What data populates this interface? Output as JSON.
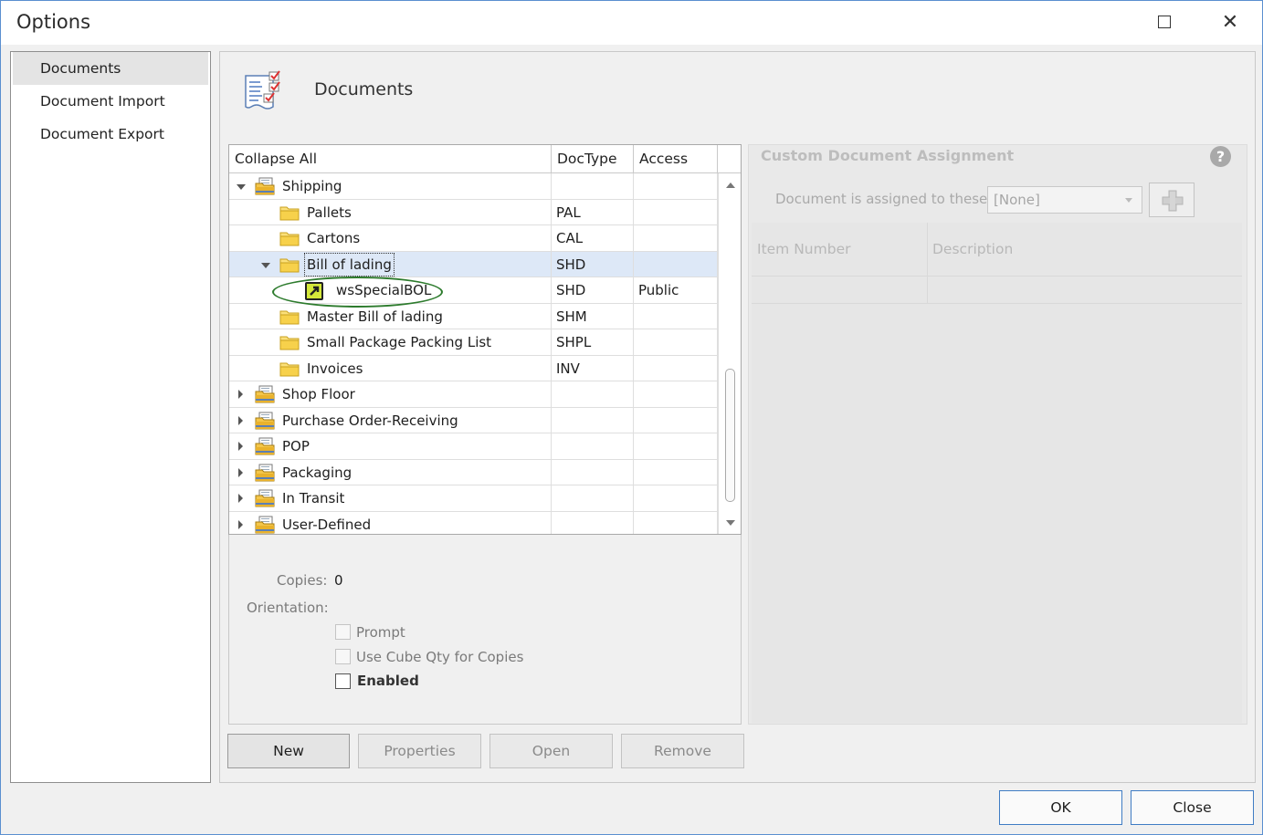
{
  "window": {
    "title": "Options",
    "maximize_icon": "maximize-icon",
    "close_glyph": "✕"
  },
  "nav": {
    "items": [
      {
        "label": "Documents",
        "selected": true
      },
      {
        "label": "Document Import",
        "selected": false
      },
      {
        "label": "Document Export",
        "selected": false
      }
    ]
  },
  "header": {
    "title": "Documents",
    "icon": "document-checklist-icon"
  },
  "grid": {
    "columns": [
      "Collapse All",
      "DocType",
      "Access"
    ],
    "rows": [
      {
        "label": "Shipping",
        "doctype": "",
        "access": "",
        "level": 0,
        "icon": "category-folder-icon",
        "expander": "expanded"
      },
      {
        "label": "Pallets",
        "doctype": "PAL",
        "access": "",
        "level": 1,
        "icon": "folder-icon",
        "expander": "none"
      },
      {
        "label": "Cartons",
        "doctype": "CAL",
        "access": "",
        "level": 1,
        "icon": "folder-icon",
        "expander": "none"
      },
      {
        "label": "Bill of lading",
        "doctype": "SHD",
        "access": "",
        "level": 1,
        "icon": "folder-icon",
        "expander": "expanded",
        "selected": true
      },
      {
        "label": "wsSpecialBOL",
        "doctype": "SHD",
        "access": "Public",
        "level": 2,
        "icon": "custom-document-icon",
        "expander": "none"
      },
      {
        "label": "Master Bill of lading",
        "doctype": "SHM",
        "access": "",
        "level": 1,
        "icon": "folder-icon",
        "expander": "none"
      },
      {
        "label": "Small Package Packing List",
        "doctype": "SHPL",
        "access": "",
        "level": 1,
        "icon": "folder-icon",
        "expander": "none"
      },
      {
        "label": "Invoices",
        "doctype": "INV",
        "access": "",
        "level": 1,
        "icon": "folder-icon",
        "expander": "none"
      },
      {
        "label": "Shop Floor",
        "doctype": "",
        "access": "",
        "level": 0,
        "icon": "category-folder-icon",
        "expander": "collapsed"
      },
      {
        "label": "Purchase Order-Receiving",
        "doctype": "",
        "access": "",
        "level": 0,
        "icon": "category-folder-icon",
        "expander": "collapsed"
      },
      {
        "label": "POP",
        "doctype": "",
        "access": "",
        "level": 0,
        "icon": "category-folder-icon",
        "expander": "collapsed"
      },
      {
        "label": "Packaging",
        "doctype": "",
        "access": "",
        "level": 0,
        "icon": "category-folder-icon",
        "expander": "collapsed"
      },
      {
        "label": "In Transit",
        "doctype": "",
        "access": "",
        "level": 0,
        "icon": "category-folder-icon",
        "expander": "collapsed"
      },
      {
        "label": "User-Defined",
        "doctype": "",
        "access": "",
        "level": 0,
        "icon": "category-folder-icon",
        "expander": "collapsed"
      }
    ]
  },
  "settings": {
    "copies_label": "Copies:",
    "copies_value": "0",
    "orientation_label": "Orientation:",
    "prompt_label": "Prompt",
    "prompt_checked": false,
    "cube_label": "Use Cube Qty  for Copies",
    "cube_checked": false,
    "enabled_label": "Enabled",
    "enabled_checked": false
  },
  "actions": {
    "new": "New",
    "properties": "Properties",
    "open": "Open",
    "remove": "Remove"
  },
  "custom_assignment": {
    "title": "Custom Document Assignment",
    "help_glyph": "?",
    "assigned_label": "Document is assigned to these:",
    "assigned_value": "[None]",
    "add_icon": "plus-icon",
    "columns": [
      "Item Number",
      "Description"
    ]
  },
  "footer": {
    "ok": "OK",
    "close": "Close"
  },
  "colors": {
    "accent": "#3f7cc4",
    "selection": "#dde8f7",
    "highlight_circle": "#2d7b2d"
  }
}
